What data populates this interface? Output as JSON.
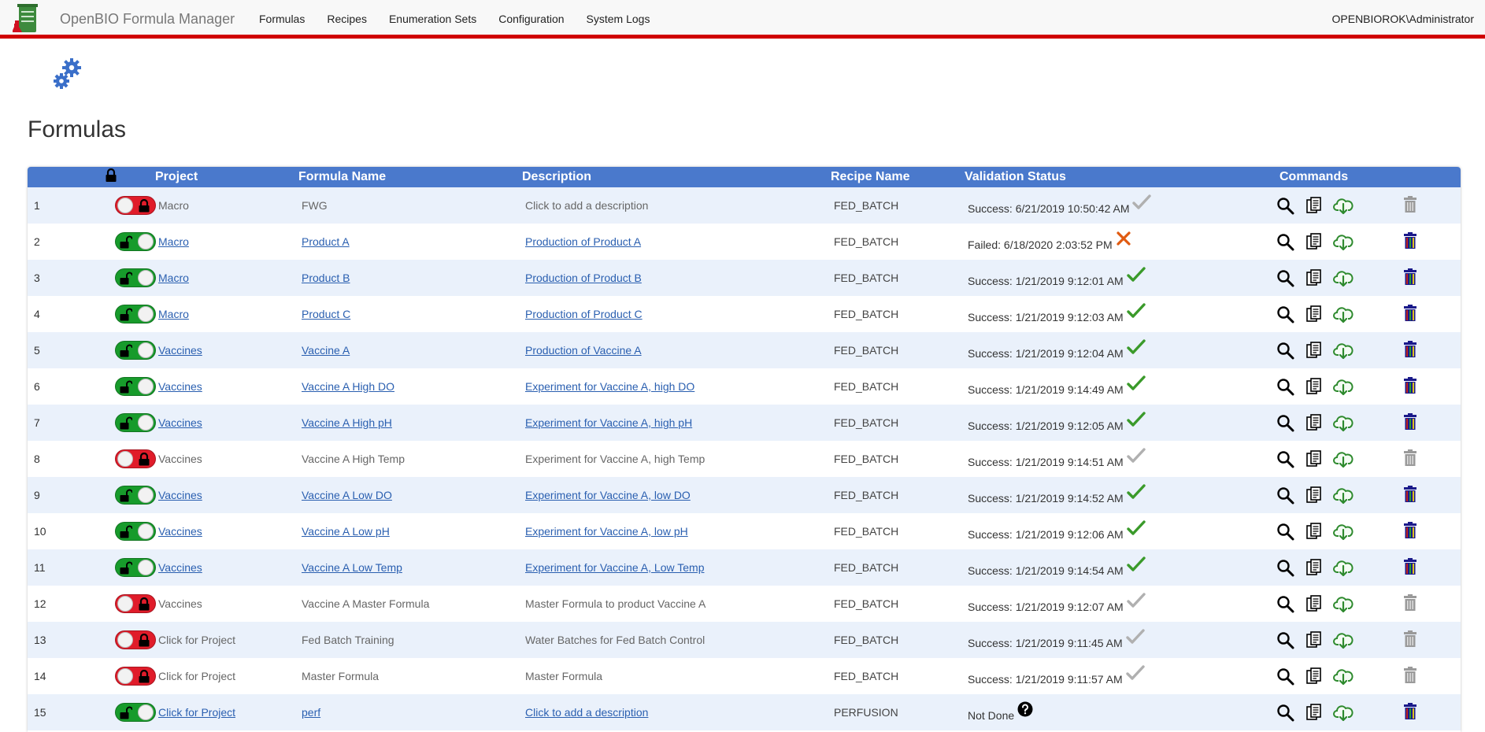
{
  "app": {
    "title": "OpenBIO Formula Manager",
    "user": "OPENBIOROK\\Administrator"
  },
  "nav": [
    "Formulas",
    "Recipes",
    "Enumeration Sets",
    "Configuration",
    "System Logs"
  ],
  "page": {
    "title": "Formulas"
  },
  "table": {
    "headers": {
      "project": "Project",
      "formula": "Formula Name",
      "description": "Description",
      "recipe": "Recipe Name",
      "validation": "Validation Status",
      "commands": "Commands"
    },
    "rows": [
      {
        "num": "1",
        "unlocked": false,
        "project": "Macro",
        "formula": "FWG",
        "description": "Click to add a description",
        "recipe": "FED_BATCH",
        "status": "Success: 6/21/2019 10:50:42 AM",
        "state": "success"
      },
      {
        "num": "2",
        "unlocked": true,
        "project": "Macro",
        "formula": "Product A",
        "description": "Production of Product A",
        "recipe": "FED_BATCH",
        "status": "Failed: 6/18/2020 2:03:52 PM",
        "state": "failed"
      },
      {
        "num": "3",
        "unlocked": true,
        "project": "Macro",
        "formula": "Product B",
        "description": "Production of Product B",
        "recipe": "FED_BATCH",
        "status": "Success: 1/21/2019 9:12:01 AM",
        "state": "success"
      },
      {
        "num": "4",
        "unlocked": true,
        "project": "Macro",
        "formula": "Product C",
        "description": "Production of Product C",
        "recipe": "FED_BATCH",
        "status": "Success: 1/21/2019 9:12:03 AM",
        "state": "success"
      },
      {
        "num": "5",
        "unlocked": true,
        "project": "Vaccines",
        "formula": "Vaccine A",
        "description": "Production of Vaccine A",
        "recipe": "FED_BATCH",
        "status": "Success: 1/21/2019 9:12:04 AM",
        "state": "success"
      },
      {
        "num": "6",
        "unlocked": true,
        "project": "Vaccines",
        "formula": "Vaccine A High DO",
        "description": "Experiment for Vaccine A, high DO",
        "recipe": "FED_BATCH",
        "status": "Success: 1/21/2019 9:14:49 AM",
        "state": "success"
      },
      {
        "num": "7",
        "unlocked": true,
        "project": "Vaccines",
        "formula": "Vaccine A High pH",
        "description": "Experiment for Vaccine A, high pH",
        "recipe": "FED_BATCH",
        "status": "Success: 1/21/2019 9:12:05 AM",
        "state": "success"
      },
      {
        "num": "8",
        "unlocked": false,
        "project": "Vaccines",
        "formula": "Vaccine A High Temp",
        "description": "Experiment for Vaccine A, high Temp",
        "recipe": "FED_BATCH",
        "status": "Success: 1/21/2019 9:14:51 AM",
        "state": "success"
      },
      {
        "num": "9",
        "unlocked": true,
        "project": "Vaccines",
        "formula": "Vaccine A Low DO",
        "description": "Experiment for Vaccine A, low DO",
        "recipe": "FED_BATCH",
        "status": "Success: 1/21/2019 9:14:52 AM",
        "state": "success"
      },
      {
        "num": "10",
        "unlocked": true,
        "project": "Vaccines",
        "formula": "Vaccine A Low pH",
        "description": "Experiment for Vaccine A, low pH",
        "recipe": "FED_BATCH",
        "status": "Success: 1/21/2019 9:12:06 AM",
        "state": "success"
      },
      {
        "num": "11",
        "unlocked": true,
        "project": "Vaccines",
        "formula": "Vaccine A Low Temp",
        "description": "Experiment for Vaccine A, Low Temp",
        "recipe": "FED_BATCH",
        "status": "Success: 1/21/2019 9:14:54 AM",
        "state": "success"
      },
      {
        "num": "12",
        "unlocked": false,
        "project": "Vaccines",
        "formula": "Vaccine A Master Formula",
        "description": "Master Formula to product Vaccine A",
        "recipe": "FED_BATCH",
        "status": "Success: 1/21/2019 9:12:07 AM",
        "state": "success"
      },
      {
        "num": "13",
        "unlocked": false,
        "project": "Click for Project",
        "formula": "Fed Batch Training",
        "description": "Water Batches for Fed Batch Control",
        "recipe": "FED_BATCH",
        "status": "Success: 1/21/2019 9:11:45 AM",
        "state": "success"
      },
      {
        "num": "14",
        "unlocked": false,
        "project": "Click for Project",
        "formula": "Master Formula",
        "description": "Master Formula",
        "recipe": "FED_BATCH",
        "status": "Success: 1/21/2019 9:11:57 AM",
        "state": "success"
      },
      {
        "num": "15",
        "unlocked": true,
        "project": "Click for Project",
        "formula": "perf",
        "description": "Click to add a description",
        "recipe": "PERFUSION",
        "status": "Not Done",
        "state": "notdone"
      }
    ]
  },
  "colors": {
    "accent": "#4a79cc",
    "topbar_border": "#d00000",
    "unlocked": "#179b2b",
    "locked": "#e01c2a",
    "check_active": "#3a9a2a",
    "check_locked": "#b0b0b0",
    "failed": "#e05a10"
  }
}
